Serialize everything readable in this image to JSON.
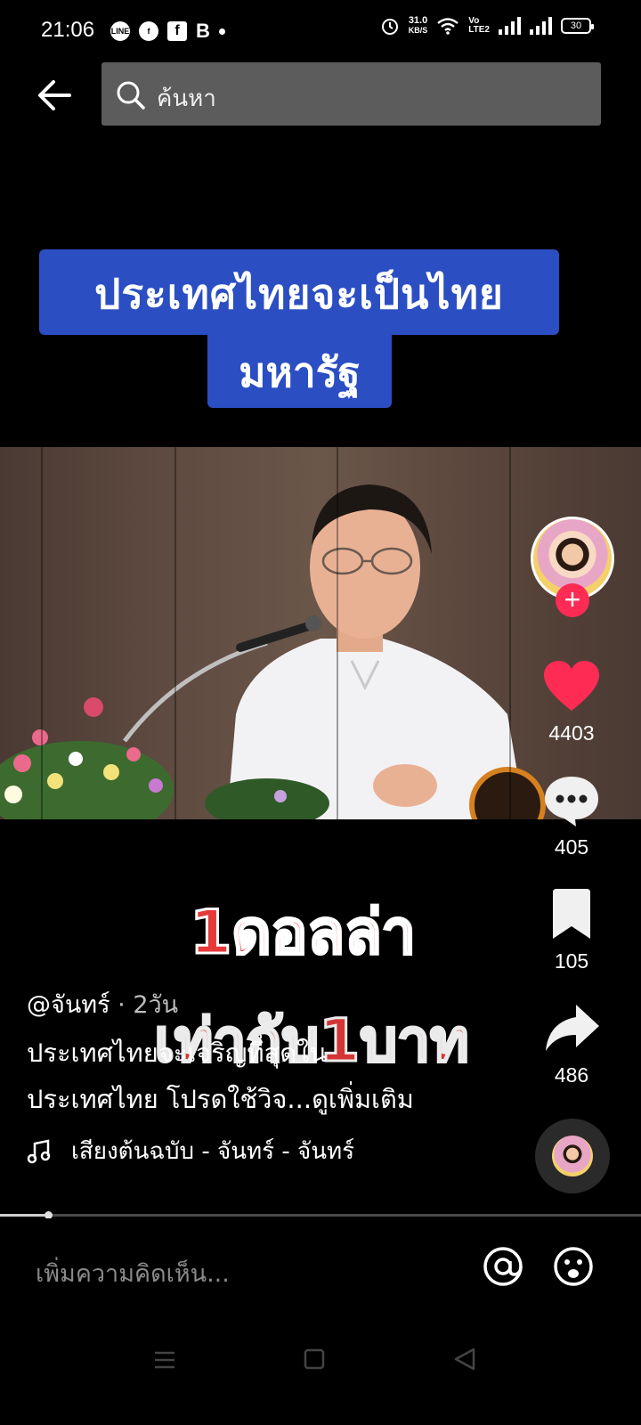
{
  "status_bar": {
    "time": "21:06",
    "left_icons": [
      "line-icon",
      "facebook-messenger-icon",
      "facebook-icon",
      "b-icon",
      "dot-icon"
    ],
    "net_speed_value": "31.0",
    "net_speed_unit": "KB/S",
    "volte_top": "Vo",
    "volte_bottom": "LTE2",
    "battery": "30"
  },
  "search": {
    "placeholder": "ค้นหา"
  },
  "video": {
    "title_line_1": "ประเทศไทยจะเป็นไทย",
    "title_line_2": "มหารัฐ",
    "caption_line_1": "1ดอลล่า",
    "caption_line_2": "เท่ากับ1บาท"
  },
  "rail": {
    "likes": "4403",
    "comments": "405",
    "bookmarks": "105",
    "shares": "486",
    "follow_symbol": "+"
  },
  "post": {
    "username": "@จันทร์",
    "time_ago": " · 2วัน",
    "description_line_1": "ประเทศไทยจะเจริญที่สุดใน",
    "description_line_2": "ประเทศไทย โปรดใช้วิจ...",
    "more_label": "ดูเพิ่มเติม",
    "sound": "เสียงต้นฉบับ - จันทร์ - จันทร์"
  },
  "playback": {
    "progress_fraction": 0.075
  },
  "comment_bar": {
    "placeholder": "เพิ่มความคิดเห็น..."
  },
  "colors": {
    "accent_red": "#fe2c55",
    "title_band_blue": "#2b4ec2",
    "caption_red": "#e63a3a",
    "search_bg": "#5c5c5c"
  }
}
